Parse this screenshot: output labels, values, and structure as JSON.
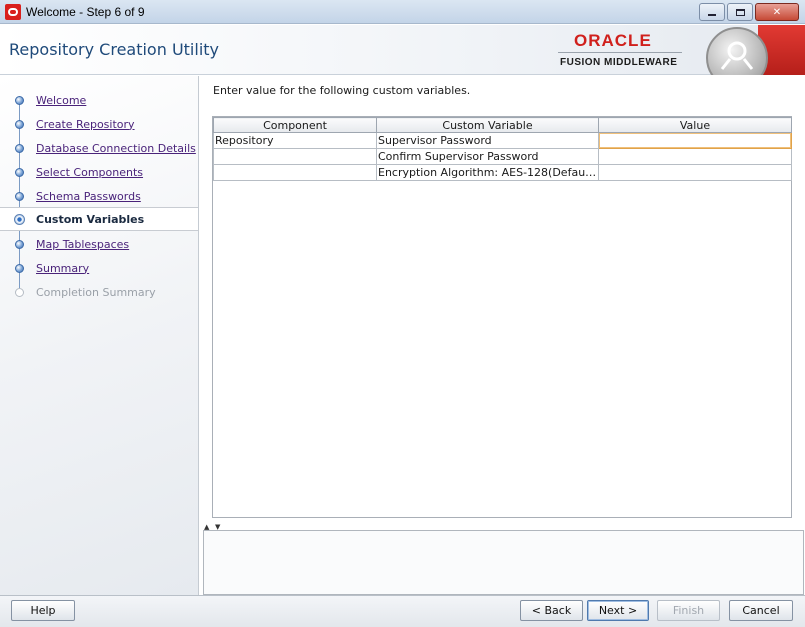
{
  "window": {
    "title": "Welcome - Step 6 of 9",
    "buttons": {
      "minimize": "–",
      "maximize": "□",
      "close": "✕"
    }
  },
  "header": {
    "title": "Repository Creation Utility",
    "brand_oracle": "ORACLE",
    "brand_fusion": "FUSION MIDDLEWARE"
  },
  "nav": {
    "steps": [
      {
        "label": "Welcome",
        "state": "done"
      },
      {
        "label": "Create Repository",
        "state": "done"
      },
      {
        "label": "Database Connection Details",
        "state": "done"
      },
      {
        "label": "Select Components",
        "state": "done"
      },
      {
        "label": "Schema Passwords",
        "state": "done"
      },
      {
        "label": "Custom Variables",
        "state": "current"
      },
      {
        "label": "Map Tablespaces",
        "state": "pending"
      },
      {
        "label": "Summary",
        "state": "pending"
      },
      {
        "label": "Completion Summary",
        "state": "disabled"
      }
    ]
  },
  "main": {
    "instruction": "Enter value for the following custom variables.",
    "table": {
      "columns": [
        "Component",
        "Custom Variable",
        "Value"
      ],
      "rows": [
        {
          "component": "Repository",
          "variable": "Supervisor Password",
          "value": ""
        },
        {
          "component": "",
          "variable": "Confirm Supervisor Password",
          "value": ""
        },
        {
          "component": "",
          "variable": "Encryption Algorithm: AES-128(Default...",
          "value": ""
        }
      ]
    }
  },
  "footer": {
    "help": "Help",
    "back": "< Back",
    "next": "Next >",
    "finish": "Finish",
    "cancel": "Cancel"
  },
  "colors": {
    "accent": "#1f4a7a",
    "brand_red": "#d0201c",
    "link": "#4a237a"
  }
}
